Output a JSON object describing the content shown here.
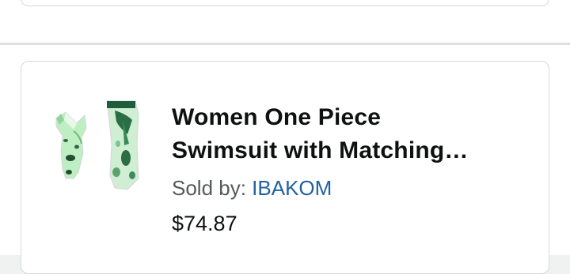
{
  "product": {
    "title_line1": "Women One Piece",
    "title_line2": "Swimsuit with Matching…",
    "sold_by_label": "Sold by: ",
    "seller_name": "IBAKOM",
    "price": "$74.87",
    "image_icon": "swimsuit-and-sarong-image"
  },
  "colors": {
    "seller_link": "#2162a1",
    "text": "#0f1111",
    "muted": "#565959",
    "card_border": "#d5d9d9",
    "page_bg": "#f0f2f2",
    "product_green": "#9fdca9",
    "product_dark_green": "#1f5e3a"
  }
}
